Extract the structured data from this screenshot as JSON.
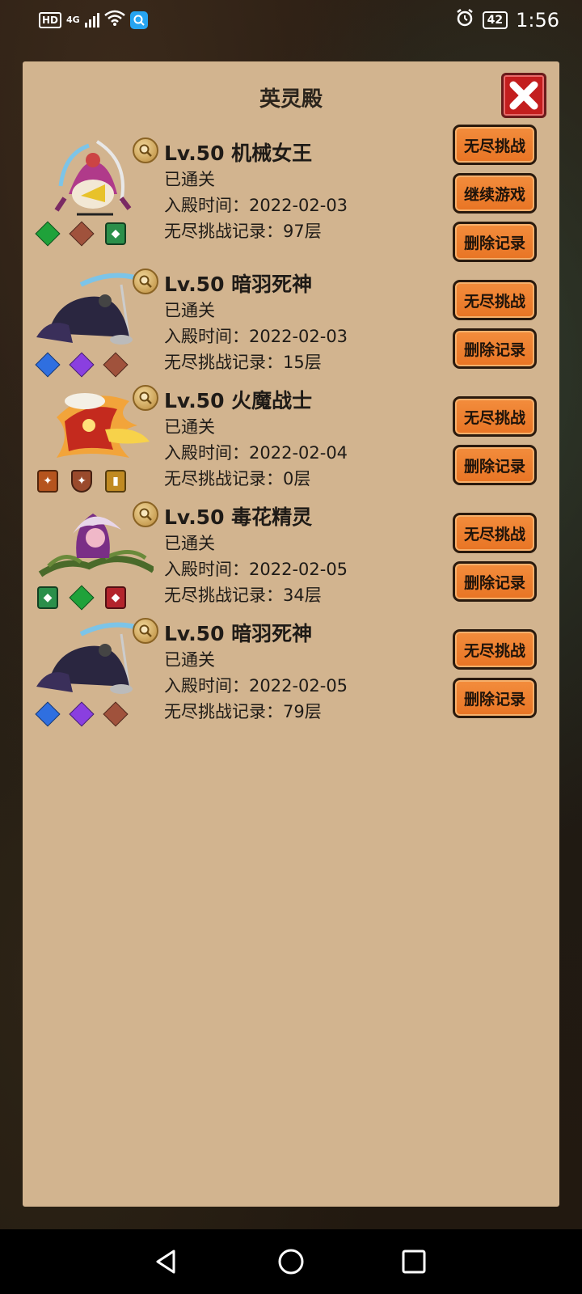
{
  "status_bar": {
    "hd": "HD",
    "network": "4G",
    "battery": "42",
    "time": "1:56"
  },
  "dialog": {
    "title": "英灵殿",
    "close_icon": "close-x-icon"
  },
  "buttons": {
    "endless": "无尽挑战",
    "continue": "继续游戏",
    "delete": "删除记录"
  },
  "heroes": [
    {
      "name": "Lv.50 机械女王",
      "status": "已通关",
      "enter_time": "入殿时间：2022-02-03",
      "record": "无尽挑战记录：97层",
      "gem_colors": [
        "#1fa23a",
        "#a0523c",
        "#2b8f4a"
      ]
    },
    {
      "name": "Lv.50 暗羽死神",
      "status": "已通关",
      "enter_time": "入殿时间：2022-02-03",
      "record": "无尽挑战记录：15层",
      "gem_colors": [
        "#2f6fe0",
        "#8a3fe0",
        "#a0523c"
      ]
    },
    {
      "name": "Lv.50 火魔战士",
      "status": "已通关",
      "enter_time": "入殿时间：2022-02-04",
      "record": "无尽挑战记录：0层",
      "gem_colors": [
        "#b5541e",
        "#9a4a2c",
        "#c08a22"
      ]
    },
    {
      "name": "Lv.50 毒花精灵",
      "status": "已通关",
      "enter_time": "入殿时间：2022-02-05",
      "record": "无尽挑战记录：34层",
      "gem_colors": [
        "#2b8f4a",
        "#1fa23a",
        "#b3242c"
      ]
    },
    {
      "name": "Lv.50 暗羽死神",
      "status": "已通关",
      "enter_time": "入殿时间：2022-02-05",
      "record": "无尽挑战记录：79层",
      "gem_colors": [
        "#2f6fe0",
        "#8a3fe0",
        "#a0523c"
      ]
    }
  ],
  "colors": {
    "panel": "#d2b48f",
    "button": "#e87424",
    "close": "#c31e1e"
  }
}
